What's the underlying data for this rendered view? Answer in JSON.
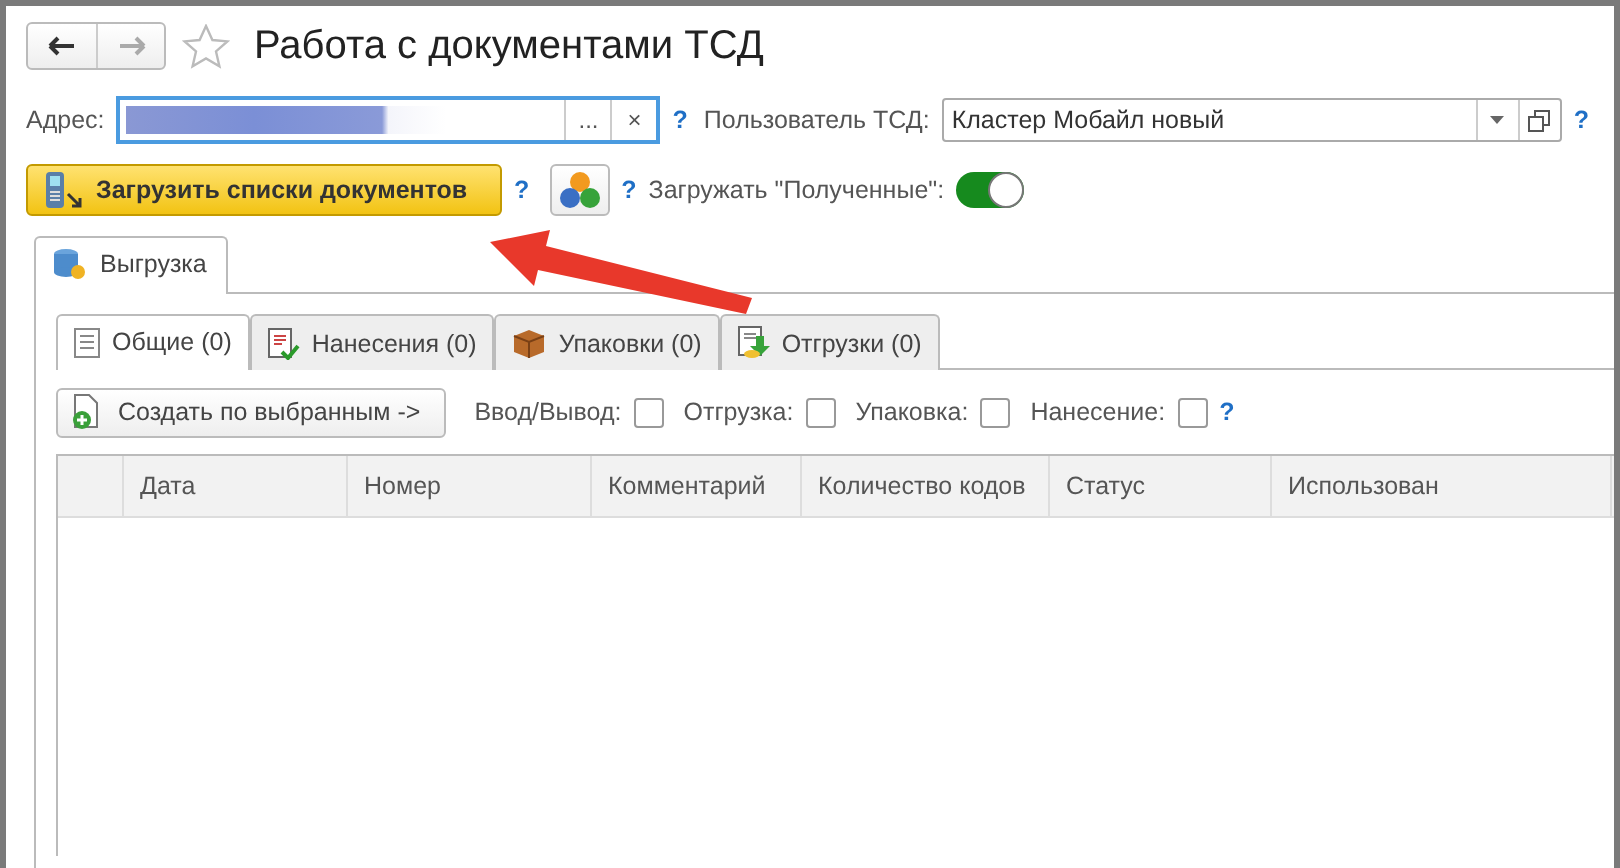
{
  "window": {
    "title": "Работа с документами ТСД"
  },
  "address": {
    "label": "Адрес:",
    "select": "...",
    "clear": "×",
    "help": "?"
  },
  "user": {
    "label": "Пользователь ТСД:",
    "value": "Кластер Мобайл новый",
    "help": "?"
  },
  "load_button": {
    "label": "Загрузить списки документов",
    "help": "?"
  },
  "load_received": {
    "help": "?",
    "label": "Загружать \"Полученные\":",
    "on": true
  },
  "outer_tabs": [
    {
      "label": "Выгрузка",
      "selected": true
    }
  ],
  "inner_tabs": [
    {
      "label": "Общие (0)",
      "selected": true
    },
    {
      "label": "Нанесения (0)",
      "selected": false
    },
    {
      "label": "Упаковки (0)",
      "selected": false
    },
    {
      "label": "Отгрузки (0)",
      "selected": false
    }
  ],
  "create_button": {
    "label": "Создать по выбранным ->"
  },
  "filters": [
    {
      "label": "Ввод/Вывод:",
      "checked": false
    },
    {
      "label": "Отгрузка:",
      "checked": false
    },
    {
      "label": "Упаковка:",
      "checked": false
    },
    {
      "label": "Нанесение:",
      "checked": false
    }
  ],
  "filters_help": "?",
  "table": {
    "columns": [
      "Дата",
      "Номер",
      "Комментарий",
      "Количество кодов",
      "Статус",
      "Использован"
    ]
  }
}
